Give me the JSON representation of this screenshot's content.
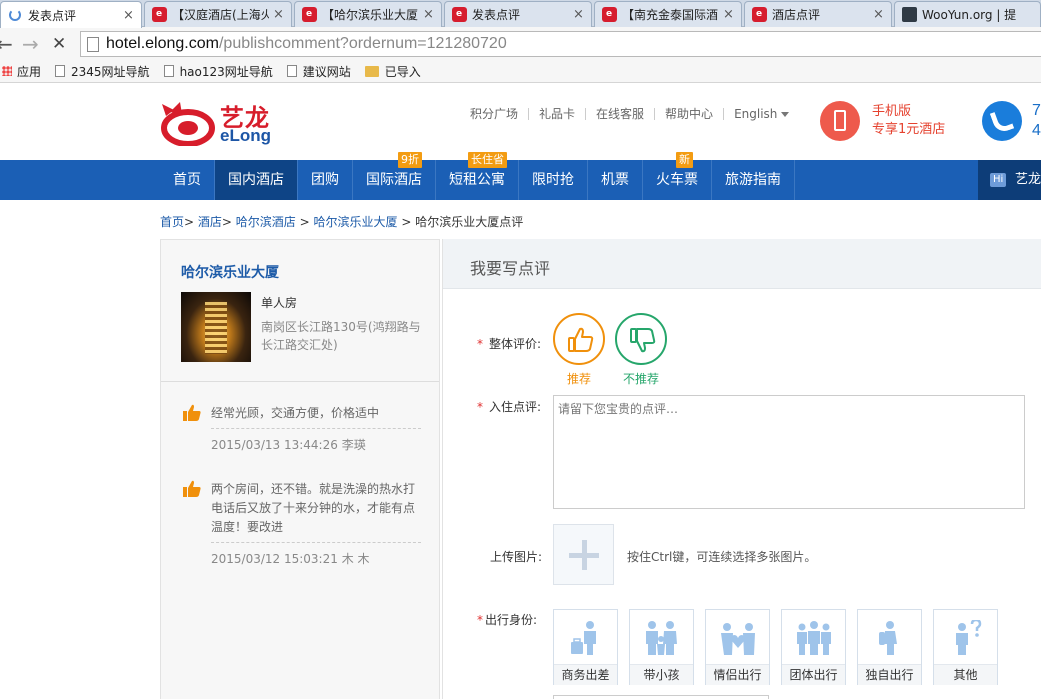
{
  "browser": {
    "tabs": [
      {
        "title": "发表点评",
        "favicon": "loading-icon",
        "active": true
      },
      {
        "title": "【汉庭酒店(上海火",
        "favicon": "elong-icon"
      },
      {
        "title": "【哈尔滨乐业大厦",
        "favicon": "elong-icon"
      },
      {
        "title": "发表点评",
        "favicon": "elong-icon"
      },
      {
        "title": "【南充金泰国际酒",
        "favicon": "elong-icon"
      },
      {
        "title": "酒店点评",
        "favicon": "elong-icon"
      },
      {
        "title": "WooYun.org | 提",
        "favicon": "wooyun-icon"
      }
    ],
    "close_glyph": "×",
    "nav": {
      "back": "←",
      "forward": "→",
      "stop": "✕"
    },
    "url": {
      "host": "hotel.elong.com",
      "path": "/publishcomment?ordernum=121280720"
    },
    "bookmarks": [
      {
        "label": "应用",
        "icon": "apps-icon"
      },
      {
        "label": "2345网址导航",
        "icon": "page-icon"
      },
      {
        "label": "hao123网址导航",
        "icon": "page-icon"
      },
      {
        "label": "建议网站",
        "icon": "page-icon"
      },
      {
        "label": "已导入",
        "icon": "folder-icon"
      }
    ]
  },
  "header": {
    "logo_cn": "艺龙",
    "logo_en": "eLong",
    "links": [
      "积分广场",
      "礼品卡",
      "在线客服",
      "帮助中心",
      "English"
    ],
    "mobile": {
      "line1": "手机版",
      "line2": "专享1元酒店"
    },
    "phone_digits": {
      "line1": "7",
      "line2": "4"
    }
  },
  "nav": {
    "items": [
      {
        "label": "首页"
      },
      {
        "label": "国内酒店",
        "active": true
      },
      {
        "label": "团购"
      },
      {
        "label": "国际酒店",
        "badge": "9折"
      },
      {
        "label": "短租公寓",
        "badge": "长住省"
      },
      {
        "label": "限时抢"
      },
      {
        "label": "机票"
      },
      {
        "label": "火车票",
        "badge": "新"
      },
      {
        "label": "旅游指南"
      }
    ],
    "hi_badge": "Hi",
    "hi_text": "艺龙"
  },
  "breadcrumb": {
    "links": [
      "首页",
      "酒店",
      "哈尔滨酒店",
      "哈尔滨乐业大厦"
    ],
    "current": "哈尔滨乐业大厦点评"
  },
  "hotel": {
    "name": "哈尔滨乐业大厦",
    "room_type": "单人房",
    "address": "南岗区长江路130号(鸿翔路与长江路交汇处)"
  },
  "reviews": [
    {
      "text": "经常光顾，交通方便，价格适中",
      "date": "2015/03/13 13:44:26",
      "author": "李瑛"
    },
    {
      "text": "两个房间，还不错。就是洗澡的热水打电话后又放了十来分钟的水，才能有点温度！要改进",
      "date": "2015/03/12 15:03:21",
      "author": "木 木"
    }
  ],
  "form": {
    "title": "我要写点评",
    "required_mark": "*",
    "overall_label": "整体评价:",
    "recommend": "推荐",
    "not_recommend": "不推荐",
    "comment_label": "入住点评:",
    "comment_placeholder": "请留下您宝贵的点评…",
    "upload_label": "上传图片:",
    "upload_hint": "按住Ctrl键，可连续选择多张图片。",
    "identity_label": "出行身份:",
    "identities": [
      "商务出差",
      "带小孩",
      "情侣出行",
      "团体出行",
      "独自出行",
      "其他"
    ]
  },
  "colors": {
    "brand_blue": "#1b5fb5",
    "brand_red": "#d71d2b",
    "recommend": "#f0900c",
    "not_recommend": "#26a66b",
    "identity_icon": "#9fc4ea"
  }
}
